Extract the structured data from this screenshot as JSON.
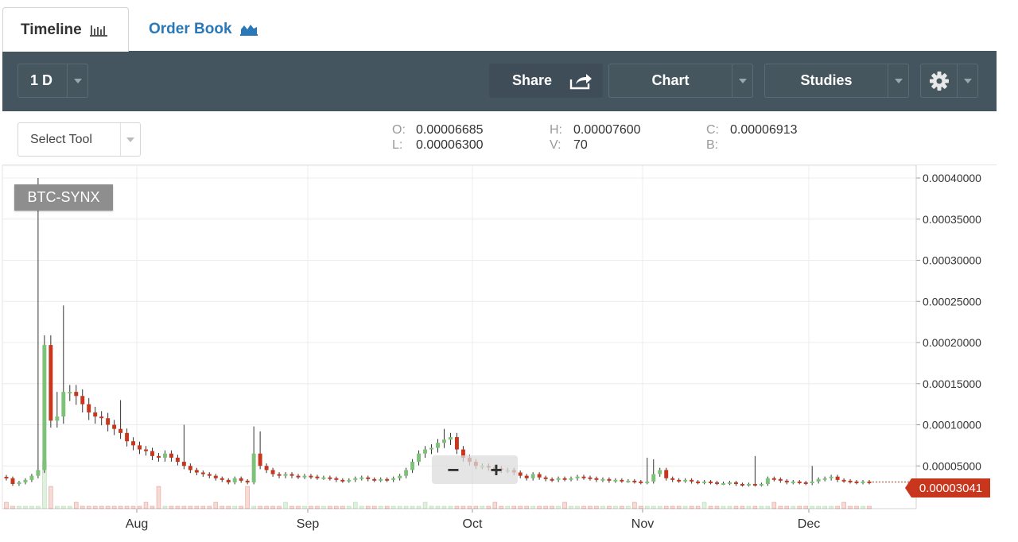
{
  "tabs": [
    {
      "label": "Timeline",
      "icon": "bar-chart-icon",
      "active": true
    },
    {
      "label": "Order Book",
      "icon": "area-chart-icon",
      "active": false
    }
  ],
  "toolbar": {
    "period": "1 D",
    "share": "Share",
    "chart": "Chart",
    "studies": "Studies",
    "settings_icon": "gear-icon"
  },
  "tool_select": {
    "label": "Select Tool"
  },
  "ohlc": {
    "O": {
      "label": "O:",
      "value": "0.00006685"
    },
    "H": {
      "label": "H:",
      "value": "0.00007600"
    },
    "C": {
      "label": "C:",
      "value": "0.00006913"
    },
    "L": {
      "label": "L:",
      "value": "0.00006300"
    },
    "V": {
      "label": "V:",
      "value": "70"
    },
    "B": {
      "label": "B:",
      "value": ""
    }
  },
  "colors": {
    "up": "#7ec27a",
    "down": "#c8361e",
    "grid": "#ececec",
    "toolbar": "#445560",
    "accent": "#2a78b8"
  },
  "chart_data": {
    "type": "candlestick",
    "symbol": "BTC-SYNX",
    "last_price": "0.00003041",
    "x_tick_labels": [
      "Aug",
      "Sep",
      "Oct",
      "Nov",
      "Dec"
    ],
    "y_tick_labels": [
      "0.00005000",
      "0.00010000",
      "0.00015000",
      "0.00020000",
      "0.00025000",
      "0.00030000",
      "0.00035000",
      "0.00040000"
    ],
    "ylim": [
      0,
      0.0004
    ],
    "grid": true,
    "close_series": [
      3.5e-05,
      2.8e-05,
      3e-05,
      3.3e-05,
      3.8e-05,
      4.5e-05,
      0.000197,
      0.000105,
      0.00011,
      0.00014,
      0.00014,
      0.000135,
      0.000125,
      0.000115,
      0.00011,
      0.000108,
      0.0001,
      9.5e-05,
      9e-05,
      8e-05,
      7.5e-05,
      7e-05,
      6.8e-05,
      6.2e-05,
      6e-05,
      6.5e-05,
      6e-05,
      5.5e-05,
      5e-05,
      4.5e-05,
      4.2e-05,
      4e-05,
      3.8e-05,
      3.5e-05,
      3.3e-05,
      3e-05,
      3.5e-05,
      3.2e-05,
      3e-05,
      6.5e-05,
      5e-05,
      4.5e-05,
      4e-05,
      3.8e-05,
      4e-05,
      3.8e-05,
      3.7e-05,
      3.8e-05,
      3.7e-05,
      3.6e-05,
      3.6e-05,
      3.5e-05,
      3.3e-05,
      3.2e-05,
      3.3e-05,
      3.5e-05,
      3.6e-05,
      3.4e-05,
      3.3e-05,
      3.4e-05,
      3.3e-05,
      3.5e-05,
      3.8e-05,
      4.5e-05,
      5.5e-05,
      6.5e-05,
      7e-05,
      7.2e-05,
      7.8e-05,
      8.2e-05,
      8.5e-05,
      7e-05,
      6e-05,
      5.5e-05,
      5e-05,
      5e-05,
      4.8e-05,
      4.7e-05,
      4.5e-05,
      4.5e-05,
      4.2e-05,
      3.8e-05,
      3.5e-05,
      4e-05,
      3.6e-05,
      3.4e-05,
      3.3e-05,
      3.5e-05,
      3.4e-05,
      3.5e-05,
      3.7e-05,
      3.6e-05,
      3.5e-05,
      3.3e-05,
      3.4e-05,
      3.2e-05,
      3.3e-05,
      3.2e-05,
      3.2e-05,
      3.1e-05,
      3e-05,
      3.1e-05,
      4e-05,
      4.5e-05,
      3.5e-05,
      3.3e-05,
      3.2e-05,
      3.3e-05,
      3.1e-05,
      3e-05,
      3.1e-05,
      3e-05,
      2.9e-05,
      2.9e-05,
      3e-05,
      2.8e-05,
      2.7e-05,
      2.8e-05,
      2.7e-05,
      2.8e-05,
      3.5e-05,
      3.4e-05,
      3.2e-05,
      3e-05,
      3.1e-05,
      3e-05,
      2.9e-05,
      3.1e-05,
      3.4e-05,
      3.5e-05,
      3.7e-05,
      3.3e-05,
      3.2e-05,
      3.1e-05,
      3e-05,
      3.1e-05,
      3e-05
    ]
  }
}
